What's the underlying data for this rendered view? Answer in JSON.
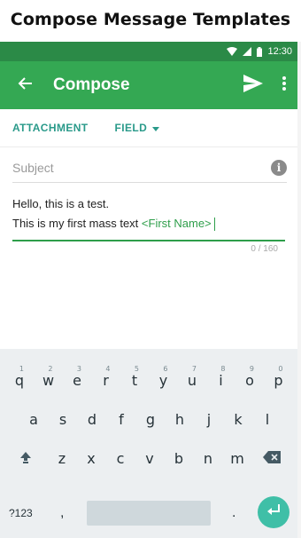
{
  "caption": "Compose Message Templates",
  "status_bar": {
    "time": "12:30"
  },
  "app_bar": {
    "title": "Compose"
  },
  "tabs": {
    "attachment": "ATTACHMENT",
    "field": "FIELD"
  },
  "subject": {
    "placeholder": "Subject"
  },
  "message": {
    "line1": "Hello, this is a test.",
    "line2": "This is my first mass text ",
    "field_token": "<First Name>",
    "counter": "0 / 160"
  },
  "keyboard": {
    "row1": [
      {
        "key": "q",
        "hint": "1"
      },
      {
        "key": "w",
        "hint": "2"
      },
      {
        "key": "e",
        "hint": "3"
      },
      {
        "key": "r",
        "hint": "4"
      },
      {
        "key": "t",
        "hint": "5"
      },
      {
        "key": "y",
        "hint": "6"
      },
      {
        "key": "u",
        "hint": "7"
      },
      {
        "key": "i",
        "hint": "8"
      },
      {
        "key": "o",
        "hint": "9"
      },
      {
        "key": "p",
        "hint": "0"
      }
    ],
    "row2": [
      "a",
      "s",
      "d",
      "f",
      "g",
      "h",
      "j",
      "k",
      "l"
    ],
    "row3": [
      "z",
      "x",
      "c",
      "v",
      "b",
      "n",
      "m"
    ],
    "symbols_key": "?123",
    "comma_key": ",",
    "period_key": "."
  },
  "colors": {
    "status_bar": "#2b8a47",
    "app_bar": "#34a853",
    "tab_text": "#2a9a8a",
    "field_token": "#2e9e4a",
    "enter_button": "#3fbfa7"
  },
  "icons": {
    "back": "arrow-back-icon",
    "send": "send-icon",
    "more": "more-vert-icon",
    "info": "info-icon",
    "shift": "shift-icon",
    "backspace": "backspace-icon",
    "enter": "enter-icon",
    "dropdown": "caret-down-icon"
  }
}
